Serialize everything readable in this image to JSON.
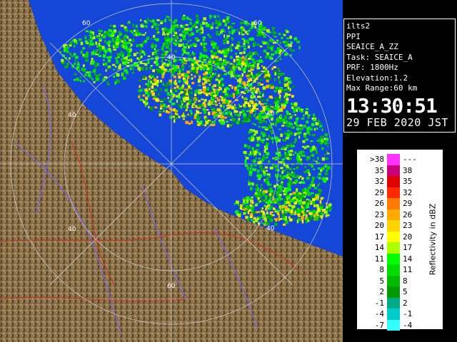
{
  "info": {
    "station": "ilts2",
    "scan_type": "PPI",
    "product": "SEAICE_A_ZZ",
    "task": "Task: SEAICE_A",
    "prf": "PRF: 1800Hz",
    "elevation": "Elevation:1.2",
    "max_range": "Max Range:60 km",
    "time": "13:30:51",
    "date": "29 FEB 2020 JST"
  },
  "range_rings": {
    "labels": [
      "60",
      "60",
      "40",
      "40",
      "40",
      "40",
      "40",
      "60"
    ]
  },
  "legend": {
    "title": "Reflectivity in dBZ",
    "rows": [
      {
        "low": ">38",
        "high": "---",
        "color": "#ff33ff"
      },
      {
        "low": "35",
        "high": "38",
        "color": "#c8007a"
      },
      {
        "low": "32",
        "high": "35",
        "color": "#e00000"
      },
      {
        "low": "29",
        "high": "32",
        "color": "#ff2a00"
      },
      {
        "low": "26",
        "high": "29",
        "color": "#ff7a00"
      },
      {
        "low": "23",
        "high": "26",
        "color": "#ffaa00"
      },
      {
        "low": "20",
        "high": "23",
        "color": "#ffd400"
      },
      {
        "low": "17",
        "high": "20",
        "color": "#ffff00"
      },
      {
        "low": "14",
        "high": "17",
        "color": "#aaff00"
      },
      {
        "low": "11",
        "high": "14",
        "color": "#00ff00"
      },
      {
        "low": "8",
        "high": "11",
        "color": "#00dd00"
      },
      {
        "low": "5",
        "high": "8",
        "color": "#00bb00"
      },
      {
        "low": "2",
        "high": "5",
        "color": "#009900"
      },
      {
        "low": "-1",
        "high": "2",
        "color": "#00aa88"
      },
      {
        "low": "-4",
        "high": "-1",
        "color": "#00cccc"
      },
      {
        "low": "-7",
        "high": "-4",
        "color": "#33ffff"
      }
    ]
  },
  "colors": {
    "sea": "#1447d8",
    "land": "#8a7048",
    "land_dark": "#4e3f28",
    "rivers": "#7766ff",
    "roads": "#cc3322",
    "ring": "#cfcfcf"
  }
}
